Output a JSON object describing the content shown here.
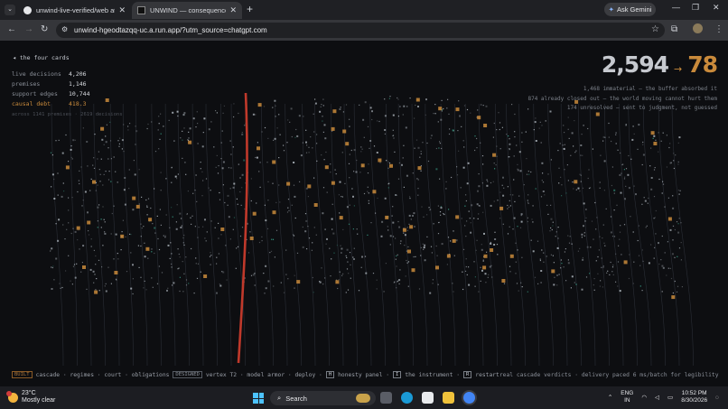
{
  "browser": {
    "tabs": [
      {
        "title": "unwind-live-verified/web at ma",
        "icon": "github-icon",
        "active": false
      },
      {
        "title": "UNWIND — consequence clear",
        "icon": "unwind-icon",
        "active": true
      }
    ],
    "new_tab": "+",
    "gemini_label": "Ask Gemini",
    "url": "unwind-hgeodtazqq-uc.a.run.app/?utm_source=chatgpt.com"
  },
  "page": {
    "back_link": "◂ the four cards",
    "stats": [
      {
        "label": "live decisions",
        "value": "4,206"
      },
      {
        "label": "premises",
        "value": "1,146"
      },
      {
        "label": "support edges",
        "value": "10,744"
      },
      {
        "label": "causal debt",
        "value": "418.3"
      }
    ],
    "across": "across 1141 premises · 2619 decisions",
    "big_from": "2,594",
    "big_arrow": "→",
    "big_to": "78",
    "notes": [
      "1,468 immaterial — the buffer absorbed it",
      "874 already closed out — the world moving cannot hurt them",
      "174 unresolved — sent to judgment, not guessed"
    ],
    "bottom": {
      "built_tag": "BUILT",
      "built_items": "cascade · regimes · court · obligations",
      "designed_tag": "DESIGNED",
      "designed_items": "vertex T2 · model armor · deploy ·",
      "key_h": "H",
      "key_h_label": "honesty panel ·",
      "key_i": "I",
      "key_i_label": "the instrument ·",
      "key_r": "R",
      "key_r_label": "restart",
      "verdict": "real cascade verdicts · delivery paced 6 ms/batch for legibility"
    },
    "colors": {
      "accent": "#c98a3b",
      "sweep": "#c0392b",
      "node": "#b8c0c8",
      "teal": "#3fb59a",
      "bg": "#0d0e11"
    }
  },
  "taskbar": {
    "temp": "23°C",
    "weather": "Mostly clear",
    "search": "Search",
    "lang": "ENG",
    "region": "IN",
    "time": "10:52 PM",
    "date": "8/30/2026"
  }
}
